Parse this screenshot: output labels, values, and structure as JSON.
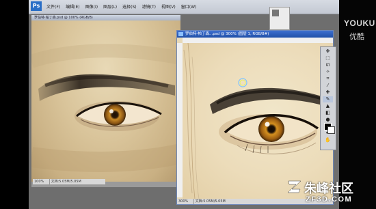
{
  "app": {
    "logo_text": "Ps",
    "menu": [
      "文件(F)",
      "编辑(E)",
      "图像(I)",
      "图层(L)",
      "选择(S)",
      "滤镜(T)",
      "视图(V)",
      "窗口(W)"
    ]
  },
  "doc_left": {
    "title": "罗伯特·帕丁森.psd @ 100% (RGB/8)",
    "status_zoom": "100%",
    "status_doc": "文档:5.05M/5.05M"
  },
  "doc_right": {
    "title": "罗伯特-帕丁森...psd @ 300% (图层 1, RGB/8#)",
    "status_zoom": "300%",
    "status_doc": "文档:5.05M/5.05M"
  },
  "watermark_top": {
    "brand_en": "YOUKU",
    "brand_cn": "优酷"
  },
  "watermark_bottom": {
    "brand_cn": "朱峰社区",
    "brand_en": "ZF3D.COM"
  },
  "colors": {
    "foreground_swatch": "#000000",
    "background_swatch": "#ffffff",
    "title_active": "#2050a8",
    "iris": "#b47a1e"
  },
  "tools": [
    "move-tool",
    "marquee-tool",
    "lasso-tool",
    "wand-tool",
    "crop-tool",
    "eyedropper-tool",
    "heal-tool",
    "brush-tool",
    "stamp-tool",
    "history-brush-tool",
    "eraser-tool",
    "gradient-tool",
    "blur-tool",
    "dodge-tool",
    "pen-tool",
    "type-tool",
    "path-select-tool",
    "shape-tool",
    "hand-tool",
    "zoom-tool"
  ]
}
